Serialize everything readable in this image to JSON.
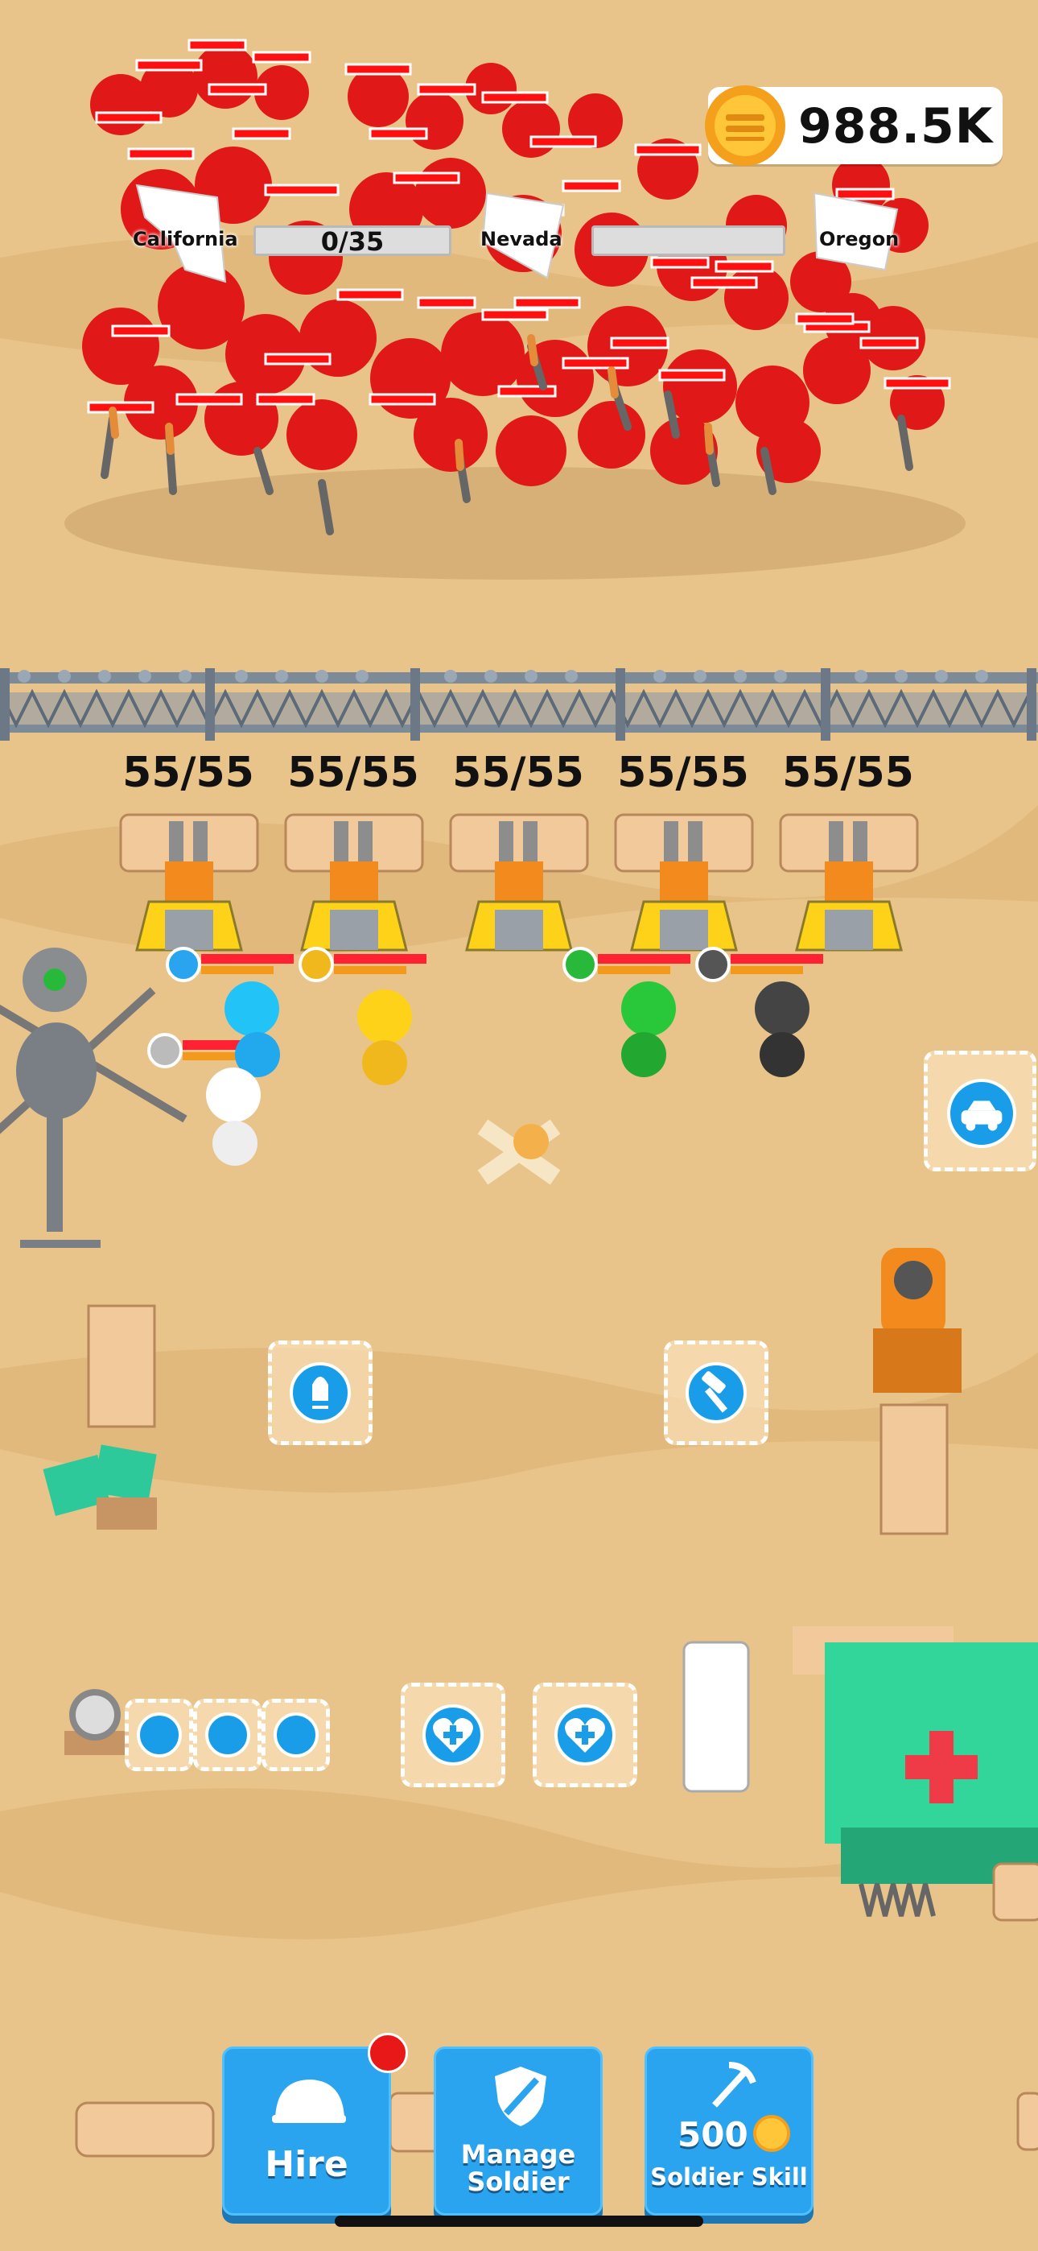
{
  "hud": {
    "coins": "988.5K",
    "coin_icon": "gold-coin-icon"
  },
  "states": [
    {
      "name": "California",
      "progress": "0/35",
      "fill": 0.0
    },
    {
      "name": "Nevada",
      "progress": "",
      "fill": 0.0
    },
    {
      "name": "Oregon",
      "progress": "",
      "fill": 0.0
    }
  ],
  "turrets": [
    {
      "hp": "55/55"
    },
    {
      "hp": "55/55"
    },
    {
      "hp": "55/55"
    },
    {
      "hp": "55/55"
    },
    {
      "hp": "55/55"
    }
  ],
  "stations": {
    "ammo_icon": "bullet-icon",
    "build_icon": "hammer-icon",
    "car_icon": "car-icon",
    "food_icon": "meat-icon",
    "heal_icon": "heart-plus-icon"
  },
  "toolbar": {
    "hire_label": "Hire",
    "manage_label_1": "Manage",
    "manage_label_2": "Soldier",
    "skill_cost": "500",
    "skill_label": "Soldier Skill"
  },
  "colors": {
    "enemy": "#e01818",
    "button": "#2aa4ee",
    "hospital": "#33d69a",
    "sand": "#e8c48a"
  }
}
